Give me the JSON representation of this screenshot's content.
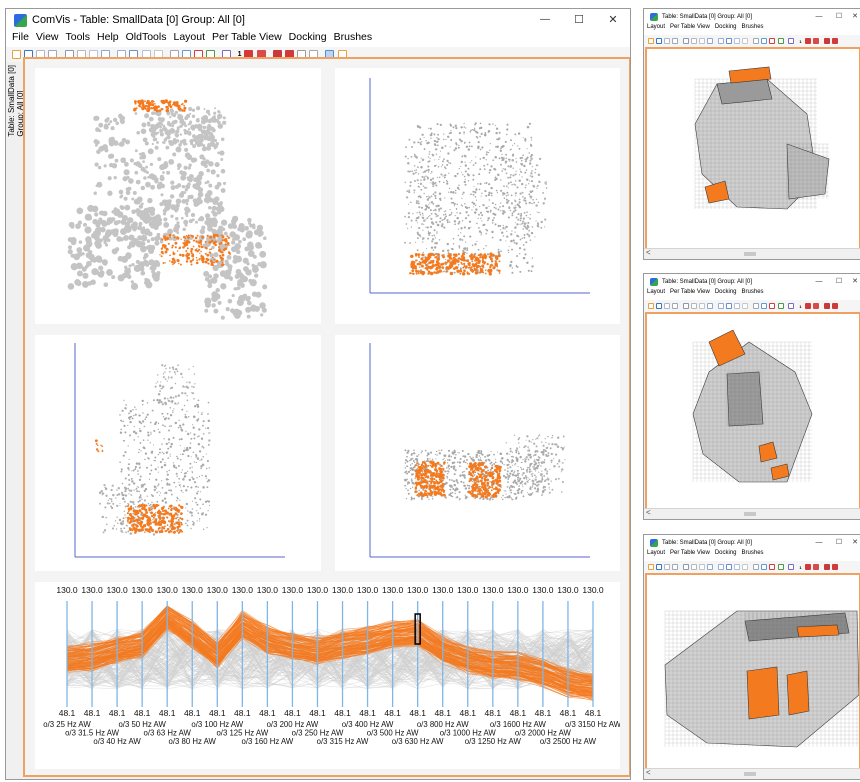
{
  "main_window": {
    "app_name": "ComVis",
    "title": "ComVis  -  Table: SmallData [0] Group: All [0]",
    "controls": {
      "minimize": "—",
      "maximize": "☐",
      "close": "✕"
    },
    "menu": [
      "File",
      "View",
      "Tools",
      "Help",
      "OldTools",
      "Layout",
      "Per Table View",
      "Docking",
      "Brushes"
    ],
    "side_tab_line1": "Table: SmallData [0]",
    "side_tab_line2": "Group: All [0]",
    "toolbar_counter": "1"
  },
  "parallel_coords": {
    "top_value": "130.0",
    "bottom_value": "48.1",
    "axes": [
      "o/3 25 Hz AW",
      "o/3 31.5 Hz AW",
      "o/3 40 Hz AW",
      "o/3 50 Hz AW",
      "o/3 63 Hz AW",
      "o/3 80 Hz AW",
      "o/3 100 Hz AW",
      "o/3 125 Hz AW",
      "o/3 160 Hz AW",
      "o/3 200 Hz AW",
      "o/3 250 Hz AW",
      "o/3 315 Hz AW",
      "o/3 400 Hz AW",
      "o/3 500 Hz AW",
      "o/3 630 Hz AW",
      "o/3 800 Hz AW",
      "o/3 1000 Hz AW",
      "o/3 1250 Hz AW",
      "o/3 1600 Hz AW",
      "o/3 2000 Hz AW",
      "o/3 2500 Hz AW",
      "o/3 3150 Hz AW"
    ],
    "brush_color": "#f47a1f",
    "context_color": "#cfcfcf",
    "axis_color": "#7fb6e6"
  },
  "side_windows": [
    {
      "title": "Table: SmallData [0] Group: All [0]",
      "menu": [
        "Layout",
        "Per Table View",
        "Docking",
        "Brushes"
      ],
      "toolbar_counter": "1",
      "scroll_arrow": "<"
    },
    {
      "title": "Table: SmallData [0] Group: All [0]",
      "menu": [
        "Layout",
        "Per Table View",
        "Docking",
        "Brushes"
      ],
      "toolbar_counter": "1",
      "scroll_arrow": "<"
    },
    {
      "title": "Table: SmallData [0] Group: All [0]",
      "menu": [
        "Layout",
        "Per Table View",
        "Docking",
        "Brushes"
      ],
      "toolbar_counter": "1",
      "scroll_arrow": "<"
    }
  ]
}
